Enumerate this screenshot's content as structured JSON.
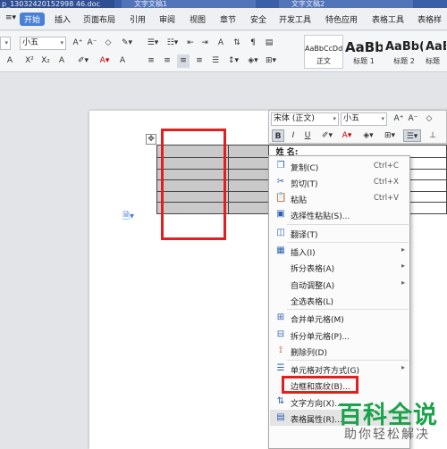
{
  "tabs": [
    {
      "label": "p_13032420152998 46.doc"
    },
    {
      "label": "文字文稿1"
    },
    {
      "label": "文字文稿2"
    }
  ],
  "menu": {
    "items": [
      "开始",
      "插入",
      "页面布局",
      "引用",
      "审阅",
      "视图",
      "章节",
      "安全",
      "开发工具",
      "特色应用",
      "表格工具",
      "表格样"
    ],
    "active": "开始"
  },
  "ribbon": {
    "font_size": "小五",
    "styles": [
      {
        "preview": "AaBbCcDd",
        "name": "正文"
      },
      {
        "preview": "AaBb",
        "name": "标题 1"
      },
      {
        "preview": "AaBb(",
        "name": "标题 2"
      },
      {
        "preview": "AaBb",
        "name": "标题"
      }
    ]
  },
  "mini_toolbar": {
    "font": "宋体 (正文)",
    "size": "小五"
  },
  "table": {
    "header": "姓  名:",
    "rows": 6
  },
  "context_menu": {
    "items": [
      {
        "icon": "copy-icon",
        "glyph": "❐",
        "label": "复制(C)",
        "shortcut": "Ctrl+C"
      },
      {
        "icon": "cut-icon",
        "glyph": "✂",
        "label": "剪切(T)",
        "shortcut": "Ctrl+X"
      },
      {
        "icon": "paste-icon",
        "glyph": "📋",
        "label": "粘贴",
        "shortcut": "Ctrl+V"
      },
      {
        "icon": "paste-special-icon",
        "glyph": "▣",
        "label": "选择性粘贴(S)..."
      },
      {
        "icon": "translate-icon",
        "glyph": "◫",
        "label": "翻译(T)"
      },
      {
        "icon": "insert-icon",
        "glyph": "▦",
        "label": "插入(I)",
        "submenu": true
      },
      {
        "icon": "",
        "glyph": "",
        "label": "拆分表格(A)",
        "submenu": true
      },
      {
        "icon": "",
        "glyph": "",
        "label": "自动调整(A)",
        "submenu": true
      },
      {
        "icon": "",
        "glyph": "",
        "label": "全选表格(L)"
      },
      {
        "icon": "merge-cells-icon",
        "glyph": "⊞",
        "label": "合并单元格(M)"
      },
      {
        "icon": "split-cells-icon",
        "glyph": "⊟",
        "label": "拆分单元格(P)..."
      },
      {
        "icon": "delete-column-icon",
        "glyph": "⟟",
        "label": "删除列(D)"
      },
      {
        "icon": "cell-align-icon",
        "glyph": "☰",
        "label": "单元格对齐方式(G)",
        "submenu": true
      },
      {
        "icon": "",
        "glyph": "",
        "label": "边框和底纹(B)..."
      },
      {
        "icon": "text-direction-icon",
        "glyph": "⇅",
        "label": "文字方向(X)..."
      },
      {
        "icon": "table-props-icon",
        "glyph": "▤",
        "label": "表格属性(R)..."
      }
    ]
  },
  "watermark": {
    "title": "百科全说",
    "subtitle": "助你轻松解决"
  },
  "colors": {
    "accent": "#4a7fd6",
    "highlight_red": "#e02020",
    "watermark_green": "#1aa34a"
  }
}
